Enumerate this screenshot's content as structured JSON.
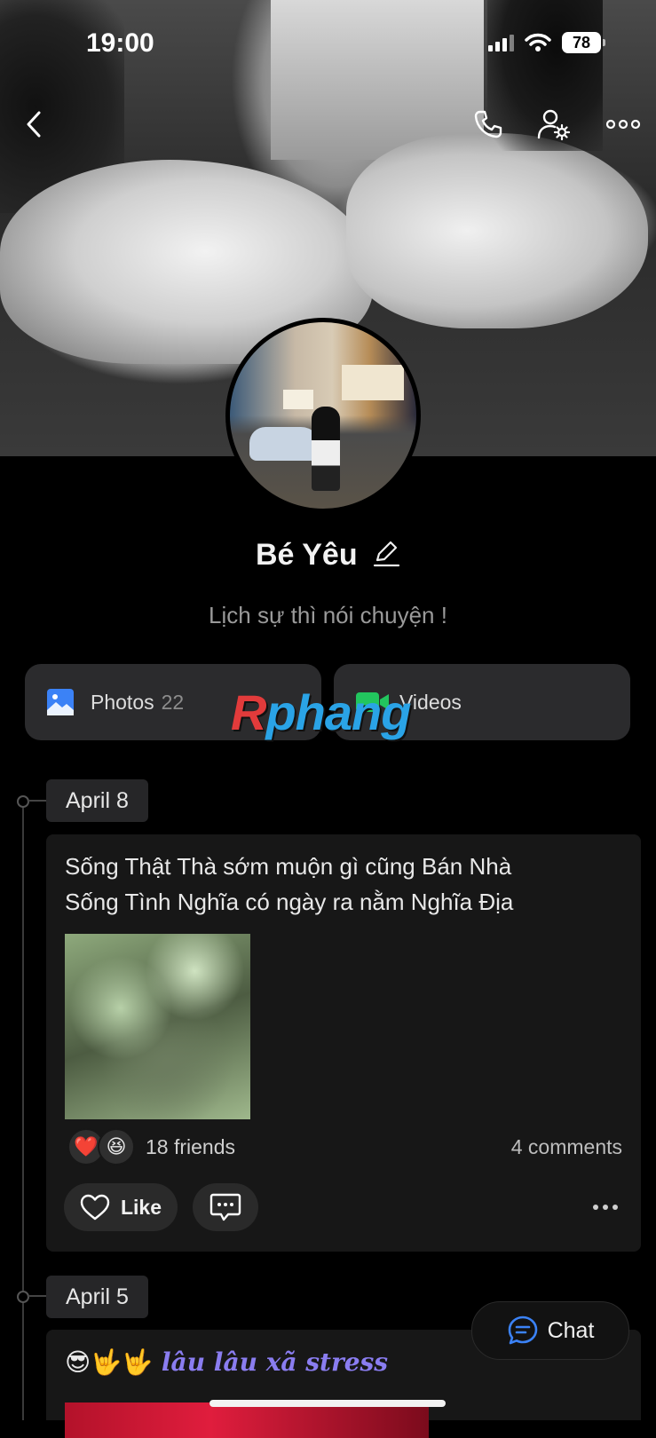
{
  "status_bar": {
    "time": "19:00",
    "battery": "78"
  },
  "profile": {
    "name": "Bé Yêu",
    "bio": "Lịch sự thì nói chuyện !"
  },
  "tiles": {
    "photos_label": "Photos",
    "photos_count": "22",
    "videos_label": "Videos"
  },
  "watermark": {
    "part1": "R",
    "part2": "phang"
  },
  "feed": {
    "post1": {
      "date": "April 8",
      "text_line1": "Sống Thật Thà sớm muộn gì cũng Bán Nhà",
      "text_line2": "Sống Tình Nghĩa có ngày ra nằm Nghĩa Địa",
      "reaction_emojis": [
        "❤️",
        "😆"
      ],
      "reactions_text": "18 friends",
      "comments_text": "4 comments",
      "like_label": "Like"
    },
    "post2": {
      "date": "April 5",
      "emojis": "😎🤟🤟",
      "title": "lâu lâu xã stress"
    }
  },
  "chat_button": {
    "label": "Chat"
  },
  "colors": {
    "accent_blue": "#3b82f6",
    "background": "#000000",
    "card": "#171717"
  },
  "icons": [
    "back-icon",
    "phone-icon",
    "user-settings-icon",
    "more-icon",
    "edit-icon",
    "photos-icon",
    "videos-icon",
    "heart-icon",
    "comment-icon",
    "chat-icon"
  ]
}
